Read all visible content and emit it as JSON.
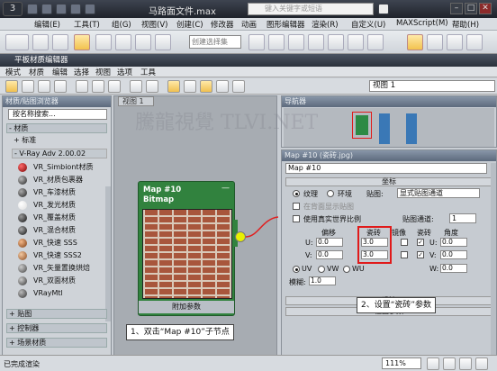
{
  "app": {
    "doc_title": "马路面文件.max",
    "search_placeholder": "键入关键字或短语",
    "logo_glyph": "3"
  },
  "menubar": [
    "编辑(E)",
    "工具(T)",
    "组(G)",
    "视图(V)",
    "创建(C)",
    "修改器",
    "动画",
    "图形编辑器",
    "渲染(R)",
    "自定义(U)",
    "MAXScript(M)",
    "帮助(H)"
  ],
  "toolbar": {
    "selection_set_placeholder": "创建选择集"
  },
  "sme": {
    "title": "平板材质编辑器",
    "menu": [
      "模式",
      "材质",
      "编辑",
      "选择",
      "视图",
      "选项",
      "工具"
    ],
    "view_select": "视图 1"
  },
  "browser": {
    "header": "材质/贴图浏览器",
    "search": "按名称搜索...",
    "cat_materials": "- 材质",
    "cat_standard": "+ 标准",
    "cat_vray": "- V-Ray Adv 2.00.02",
    "materials": [
      "VR_Simbiont材质",
      "VR_材质包裹器",
      "VR_车漆材质",
      "VR_发光材质",
      "VR_覆盖材质",
      "VR_混合材质",
      "VR_快速 SSS",
      "VR_快速 SSS2",
      "VR_矢量置换烘焙",
      "VR_双面材质",
      "VRayMtl"
    ],
    "cat_maps": "+ 贴图",
    "cat_controllers": "+ 控制器",
    "cat_scene": "+ 场景材质"
  },
  "view": {
    "tab": "视图 1",
    "node_title": "Map #10",
    "node_type": "Bitmap",
    "node_footer": "附加参数"
  },
  "navigator": {
    "header": "导航器"
  },
  "params": {
    "header": "Map #10 (瓷砖.jpg)",
    "name_field": "Map #10",
    "rollout_coords": "坐标",
    "radio_texture": "纹理",
    "radio_env": "环境",
    "mapping_label": "贴图:",
    "mapping_value": "显式贴图通道",
    "show_in_bg": "在背面显示贴图",
    "map_channel_label": "贴图通道:",
    "map_channel_value": "1",
    "use_real_world": "使用真实世界比例",
    "col_offset": "偏移",
    "col_tiling": "瓷砖",
    "col_mirror": "镜像",
    "col_tile": "瓷砖",
    "col_angle": "角度",
    "u_label": "U:",
    "v_label": "V:",
    "w_label": "W:",
    "u_offset": "0.0",
    "v_offset": "0.0",
    "u_tiling": "3.0",
    "v_tiling": "3.0",
    "u_angle": "0.0",
    "v_angle": "0.0",
    "w_angle": "0.0",
    "uv_label": "UV",
    "vw_label": "VW",
    "wu_label": "WU",
    "blur_label": "模糊:",
    "blur_value": "1.0",
    "rollout_noise": "噪波",
    "rollout_bitmap": "位图参数"
  },
  "callouts": {
    "step1": "1、双击“Map #10”子节点",
    "step2": "2、设置“瓷砖”参数"
  },
  "status": {
    "message": "已完成渲染",
    "zoom": "111%"
  },
  "watermark": "騰龍視覺 TLVI.NET",
  "colors": {
    "node_green": "#31823e",
    "highlight_red": "#e01a1a",
    "connector_yellow": "#e8f000"
  }
}
